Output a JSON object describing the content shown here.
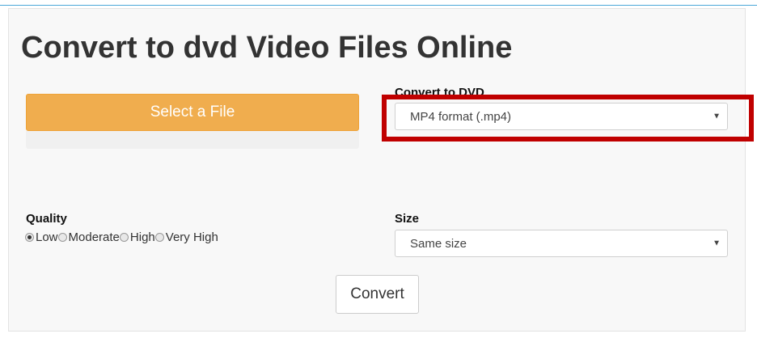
{
  "page": {
    "title": "Convert to dvd Video Files Online"
  },
  "file": {
    "select_label": "Select a File"
  },
  "convert_to": {
    "label": "Convert to DVD",
    "selected": "MP4 format (.mp4)"
  },
  "quality": {
    "label": "Quality",
    "options": [
      {
        "label": "Low",
        "checked": true
      },
      {
        "label": "Moderate",
        "checked": false
      },
      {
        "label": "High",
        "checked": false
      },
      {
        "label": "Very High",
        "checked": false
      }
    ]
  },
  "size": {
    "label": "Size",
    "selected": "Same size"
  },
  "actions": {
    "convert_label": "Convert"
  },
  "colors": {
    "select_button": "#f0ad4e",
    "highlight": "#c00000",
    "top_border": "#4aa7d8"
  },
  "icons": {
    "dropdown": "caret-down-icon",
    "radio": "radio-icon"
  }
}
